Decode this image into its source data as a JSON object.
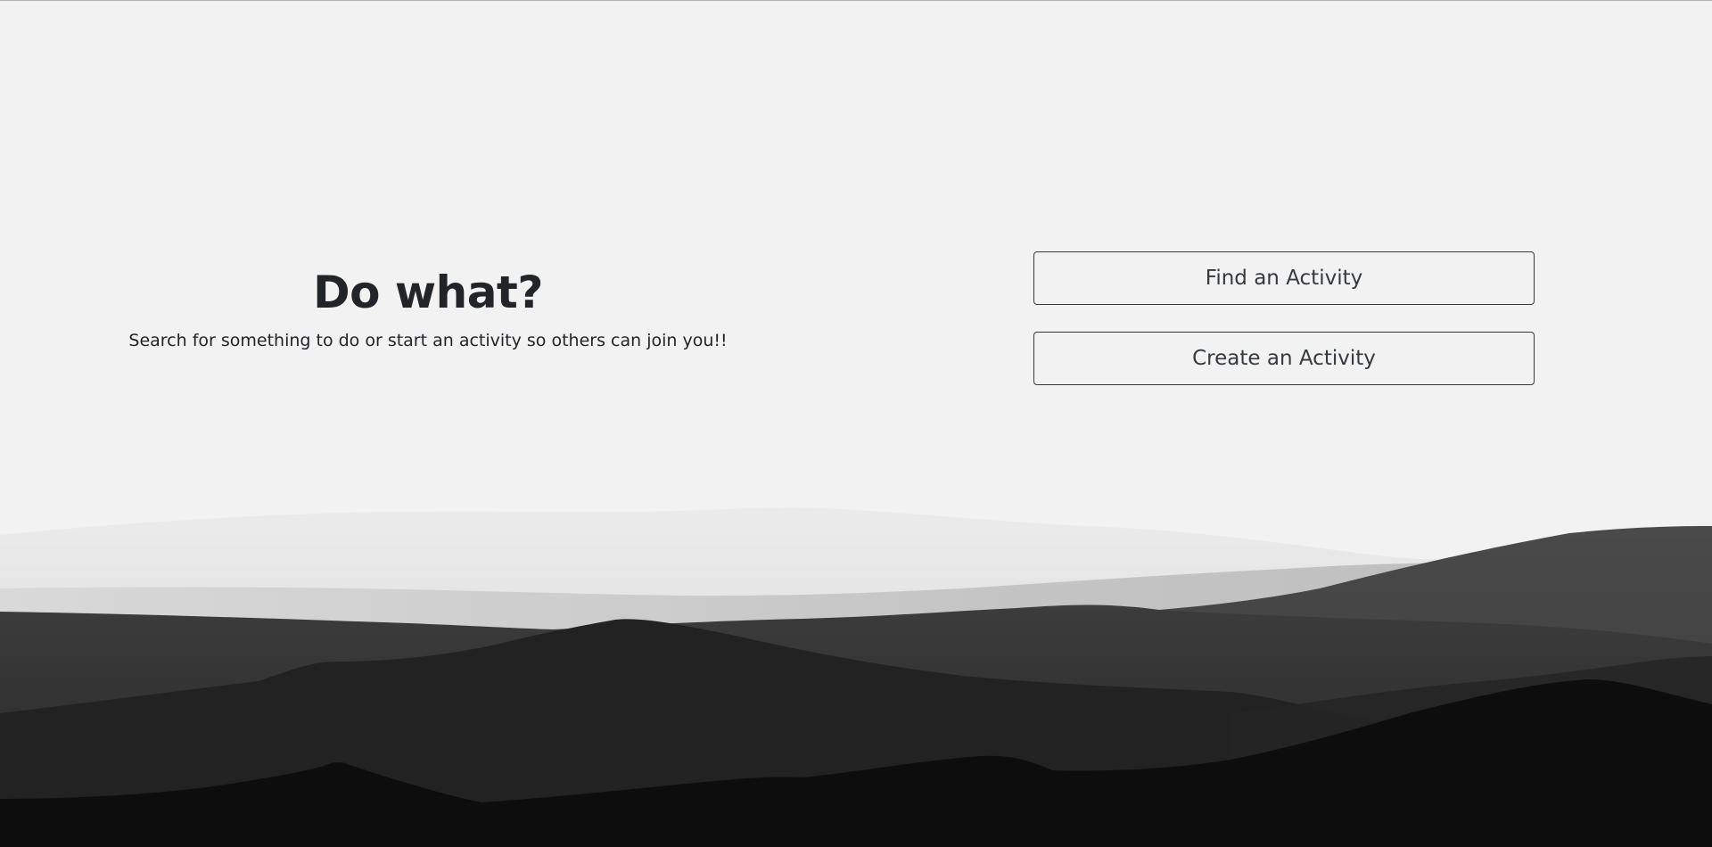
{
  "hero": {
    "title": "Do what?",
    "subtitle": "Search for something to do or start an activity so others can join you!!"
  },
  "actions": {
    "find_label": "Find an Activity",
    "create_label": "Create an Activity"
  },
  "colors": {
    "background": "#f2f2f2",
    "text": "#212529",
    "button_border": "#343a40",
    "mountains_dark": "#0c0c0c"
  }
}
